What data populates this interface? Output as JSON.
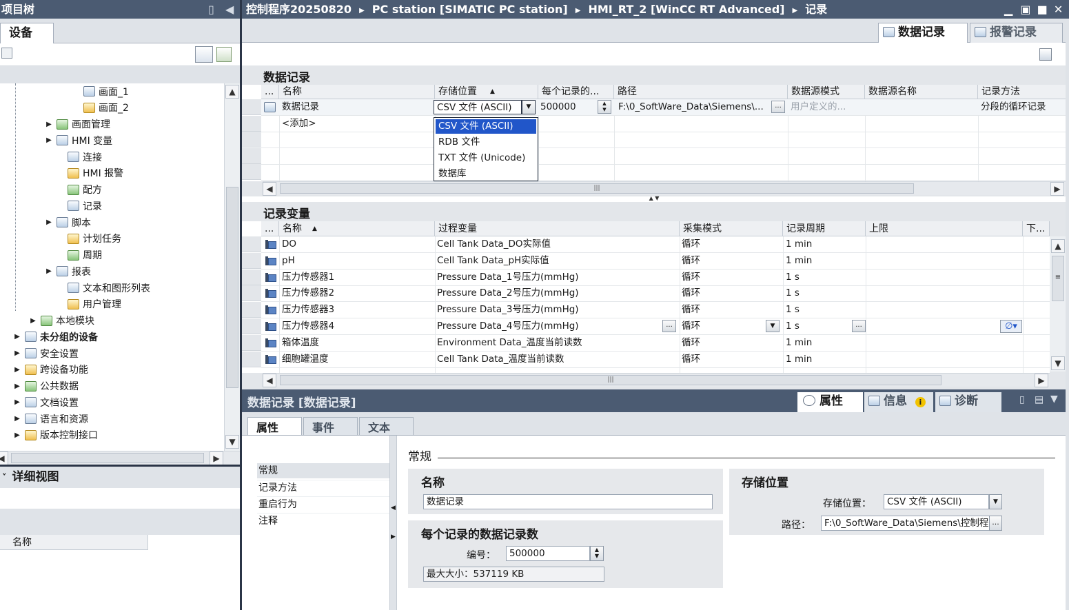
{
  "left": {
    "title": "项目树",
    "tab": "设备",
    "tree": [
      {
        "label": "画面_1",
        "indent": 105,
        "icon": "screen-icon",
        "tri": ""
      },
      {
        "label": "画面_2",
        "indent": 105,
        "icon": "screen-icon",
        "tri": ""
      },
      {
        "label": "画面管理",
        "indent": 66,
        "icon": "screen-management-icon",
        "tri": "▶"
      },
      {
        "label": "HMI 变量",
        "indent": 66,
        "icon": "hmi-tags-icon",
        "tri": "▶"
      },
      {
        "label": "连接",
        "indent": 82,
        "icon": "connection-icon",
        "tri": ""
      },
      {
        "label": "HMI 报警",
        "indent": 82,
        "icon": "hmi-alarm-icon",
        "tri": ""
      },
      {
        "label": "配方",
        "indent": 82,
        "icon": "recipe-icon",
        "tri": ""
      },
      {
        "label": "记录",
        "indent": 82,
        "icon": "log-icon",
        "tri": ""
      },
      {
        "label": "脚本",
        "indent": 66,
        "icon": "script-icon",
        "tri": "▶"
      },
      {
        "label": "计划任务",
        "indent": 82,
        "icon": "scheduled-task-icon",
        "tri": ""
      },
      {
        "label": "周期",
        "indent": 82,
        "icon": "cycle-icon",
        "tri": ""
      },
      {
        "label": "报表",
        "indent": 66,
        "icon": "report-icon",
        "tri": "▶"
      },
      {
        "label": "文本和图形列表",
        "indent": 82,
        "icon": "text-graphic-list-icon",
        "tri": ""
      },
      {
        "label": "用户管理",
        "indent": 82,
        "icon": "user-management-icon",
        "tri": ""
      },
      {
        "label": "本地模块",
        "indent": 43,
        "icon": "local-modules-icon",
        "tri": "▶"
      },
      {
        "label": "未分组的设备",
        "indent": 20,
        "icon": "ungrouped-devices-icon",
        "tri": "▶",
        "bold": true
      },
      {
        "label": "安全设置",
        "indent": 20,
        "icon": "security-settings-icon",
        "tri": "▶"
      },
      {
        "label": "跨设备功能",
        "indent": 20,
        "icon": "cross-device-icon",
        "tri": "▶"
      },
      {
        "label": "公共数据",
        "indent": 20,
        "icon": "common-data-icon",
        "tri": "▶"
      },
      {
        "label": "文档设置",
        "indent": 20,
        "icon": "document-settings-icon",
        "tri": "▶"
      },
      {
        "label": "语言和资源",
        "indent": 20,
        "icon": "languages-icon",
        "tri": "▶"
      },
      {
        "label": "版本控制接口",
        "indent": 20,
        "icon": "version-control-icon",
        "tri": "▶"
      }
    ],
    "detail_title": "详细视图",
    "detail_col": "名称"
  },
  "breadcrumb": [
    "控制程序20250820",
    "PC station [SIMATIC PC station]",
    "HMI_RT_2 [WinCC RT Advanced]",
    "记录"
  ],
  "view_tabs": {
    "data_log": "数据记录",
    "alarm_log": "报警记录"
  },
  "datalog": {
    "title": "数据记录",
    "columns": [
      "...",
      "名称",
      "存储位置",
      "每个记录的...",
      "路径",
      "数据源模式",
      "数据源名称",
      "记录方法"
    ],
    "row": {
      "name": "数据记录",
      "storage": "CSV 文件 (ASCII)",
      "count": "500000",
      "path": "F:\\0_SoftWare_Data\\Siemens\\...",
      "mode": "用户定义的...",
      "method": "分段的循环记录"
    },
    "add": "<添加>",
    "dropdown": [
      "CSV 文件 (ASCII)",
      "RDB 文件",
      "TXT 文件 (Unicode)",
      "数据库"
    ]
  },
  "tags": {
    "title": "记录变量",
    "columns": [
      "...",
      "名称",
      "过程变量",
      "采集模式",
      "记录周期",
      "上限",
      "下..."
    ],
    "rows": [
      {
        "name": "DO",
        "pv": "Cell Tank Data_DO实际值",
        "mode": "循环",
        "cycle": "1 min"
      },
      {
        "name": "pH",
        "pv": "Cell Tank Data_pH实际值",
        "mode": "循环",
        "cycle": "1 min"
      },
      {
        "name": "压力传感器1",
        "pv": "Pressure Data_1号压力(mmHg)",
        "mode": "循环",
        "cycle": "1 s"
      },
      {
        "name": "压力传感器2",
        "pv": "Pressure Data_2号压力(mmHg)",
        "mode": "循环",
        "cycle": "1 s"
      },
      {
        "name": "压力传感器3",
        "pv": "Pressure Data_3号压力(mmHg)",
        "mode": "循环",
        "cycle": "1 s"
      },
      {
        "name": "压力传感器4",
        "pv": "Pressure Data_4号压力(mmHg)",
        "mode": "循环",
        "cycle": "1 s"
      },
      {
        "name": "箱体温度",
        "pv": "Environment Data_温度当前读数",
        "mode": "循环",
        "cycle": "1 min"
      },
      {
        "name": "细胞罐温度",
        "pv": "Cell Tank Data_温度当前读数",
        "mode": "循环",
        "cycle": "1 min"
      }
    ]
  },
  "inspector": {
    "title": "数据记录 [数据记录]",
    "tabs_right": {
      "properties": "属性",
      "info": "信息",
      "diagnostics": "诊断"
    },
    "tabs": [
      "属性",
      "事件",
      "文本"
    ],
    "nav": [
      "常规",
      "记录方法",
      "重启行为",
      "注释"
    ],
    "section": "常规",
    "name_label": "名称",
    "name_value": "数据记录",
    "count_label": "每个记录的数据记录数",
    "number_label": "编号：",
    "number_value": "500000",
    "max_size": "最大大小：537119 KB",
    "storage_title": "存储位置",
    "storage_label": "存储位置：",
    "storage_value": "CSV 文件 (ASCII)",
    "path_label": "路径：",
    "path_value": "F:\\0_SoftWare_Data\\Siemens\\控制程"
  }
}
